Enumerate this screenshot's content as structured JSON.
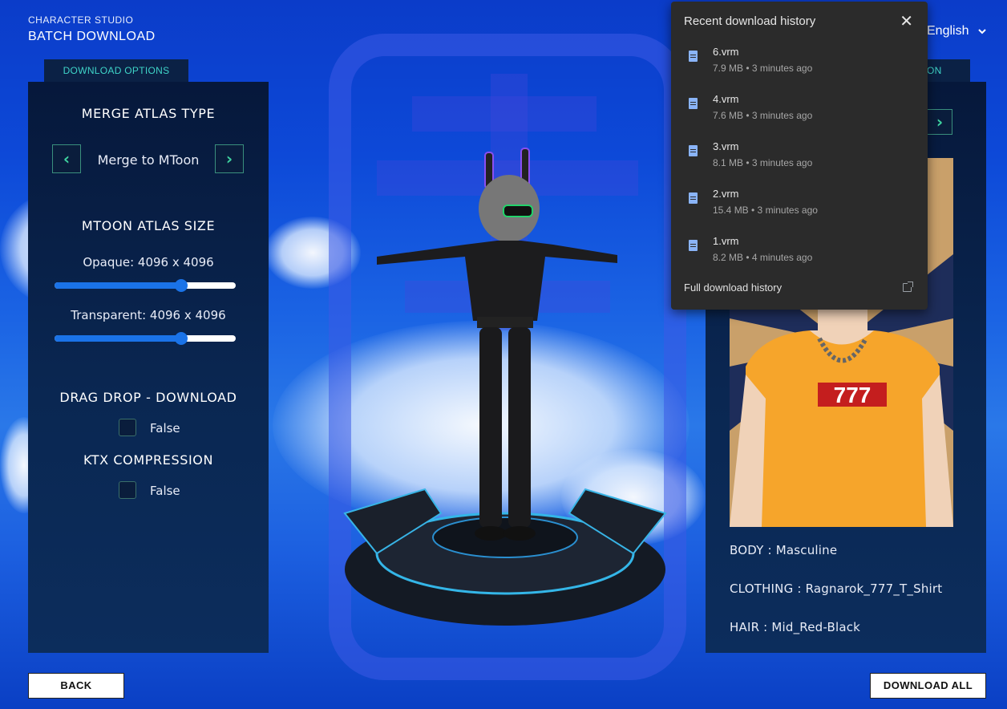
{
  "header": {
    "subtitle": "CHARACTER STUDIO",
    "title": "BATCH DOWNLOAD"
  },
  "language": {
    "selected": "English"
  },
  "left_tab": {
    "label": "DOWNLOAD OPTIONS"
  },
  "right_tab": {
    "label_fragment": "ON"
  },
  "options": {
    "merge_atlas_heading": "MERGE ATLAS TYPE",
    "merge_atlas_value": "Merge to MToon",
    "mtoon_heading": "MTOON ATLAS SIZE",
    "opaque_label": "Opaque: 4096 x 4096",
    "opaque_level": 0.7,
    "transparent_label": "Transparent: 4096 x 4096",
    "transparent_level": 0.7,
    "drag_drop_heading": "DRAG DROP - DOWNLOAD",
    "drag_drop_value": "False",
    "ktx_heading": "KTX COMPRESSION",
    "ktx_value": "False"
  },
  "preview": {
    "shirt_text": "777",
    "body": "BODY : Masculine",
    "clothing": "CLOTHING : Ragnarok_777_T_Shirt",
    "hair": "HAIR : Mid_Red-Black"
  },
  "buttons": {
    "back": "BACK",
    "download_all": "DOWNLOAD ALL"
  },
  "download_popup": {
    "title": "Recent download history",
    "items": [
      {
        "name": "6.vrm",
        "meta": "7.9 MB • 3 minutes ago"
      },
      {
        "name": "4.vrm",
        "meta": "7.6 MB • 3 minutes ago"
      },
      {
        "name": "3.vrm",
        "meta": "8.1 MB • 3 minutes ago"
      },
      {
        "name": "2.vrm",
        "meta": "15.4 MB • 3 minutes ago"
      },
      {
        "name": "1.vrm",
        "meta": "8.2 MB • 4 minutes ago"
      }
    ],
    "footer": "Full download history"
  },
  "icons": {
    "arrow_left": "chevron-left-icon",
    "arrow_right": "chevron-right-icon",
    "close": "close-icon",
    "file": "file-icon",
    "open_external": "open-external-icon",
    "dropdown": "chevron-down-icon"
  },
  "colors": {
    "accent_teal": "#3fd4c8",
    "slider_blue": "#1a73e8",
    "panel_navy": "#0a2752",
    "popup_bg": "#2b2b2b"
  }
}
